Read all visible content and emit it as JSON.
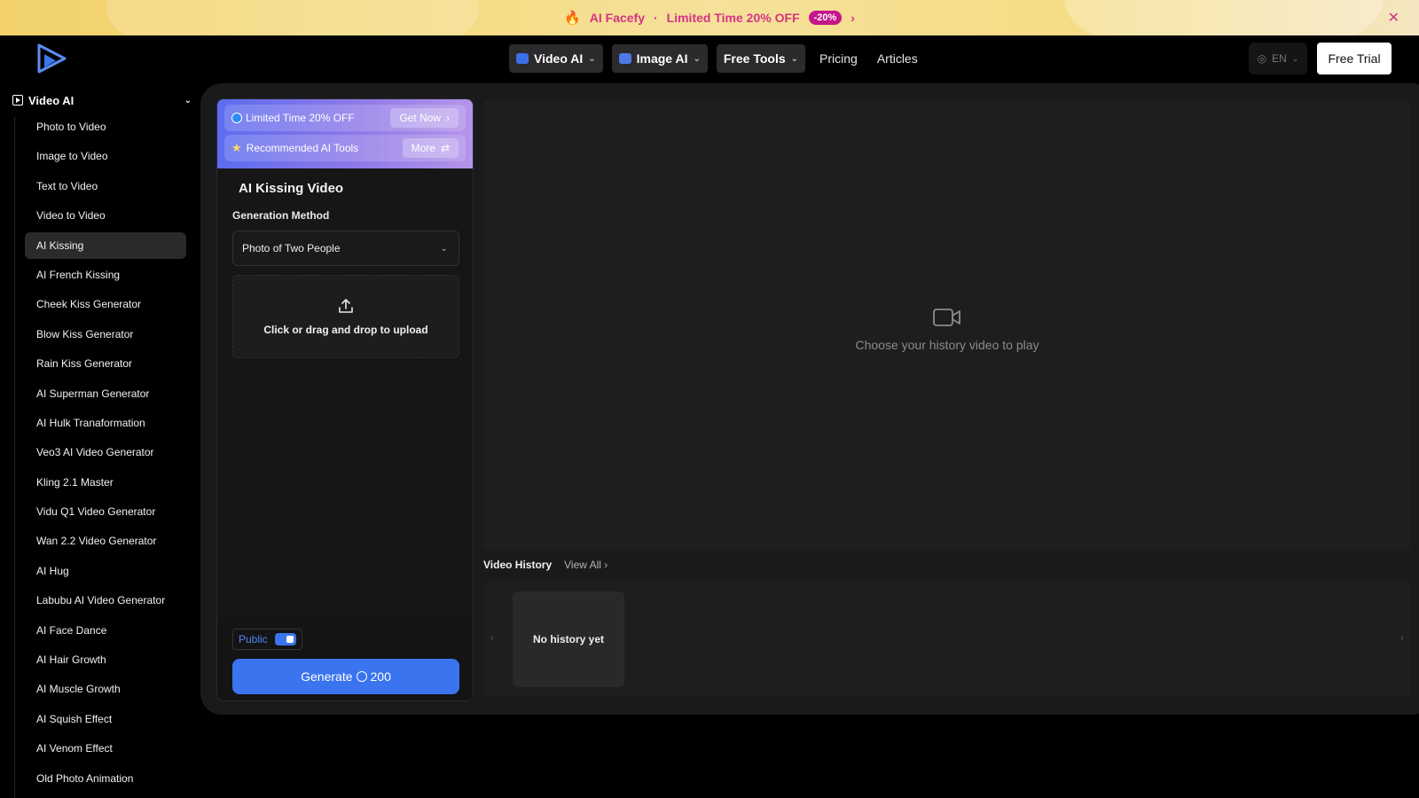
{
  "banner": {
    "brand": "AI Facefy",
    "separator": "·",
    "offer": "Limited Time 20% OFF",
    "badge": "-20%"
  },
  "nav": {
    "video_ai": "Video AI",
    "image_ai": "Image AI",
    "free_tools": "Free Tools",
    "pricing": "Pricing",
    "articles": "Articles",
    "lang": "EN",
    "free_trial": "Free Trial"
  },
  "sidebar": {
    "section": "Video AI",
    "items": [
      {
        "label": "Photo to Video"
      },
      {
        "label": "Image to Video"
      },
      {
        "label": "Text to Video"
      },
      {
        "label": "Video to Video"
      },
      {
        "label": "AI Kissing"
      },
      {
        "label": "AI French Kissing"
      },
      {
        "label": "Cheek Kiss Generator"
      },
      {
        "label": "Blow Kiss Generator"
      },
      {
        "label": "Rain Kiss Generator"
      },
      {
        "label": "AI Superman Generator"
      },
      {
        "label": "AI Hulk Tranaformation"
      },
      {
        "label": "Veo3 AI Video Generator"
      },
      {
        "label": "Kling 2.1 Master"
      },
      {
        "label": "Vidu Q1 Video Generator"
      },
      {
        "label": "Wan 2.2 Video Generator"
      },
      {
        "label": "AI Hug"
      },
      {
        "label": "Labubu AI Video Generator"
      },
      {
        "label": "AI Face Dance"
      },
      {
        "label": "AI Hair Growth"
      },
      {
        "label": "AI Muscle Growth"
      },
      {
        "label": "AI Squish Effect"
      },
      {
        "label": "AI Venom Effect"
      },
      {
        "label": "Old Photo Animation"
      }
    ],
    "active_index": 4
  },
  "panel": {
    "promo_offer": "Limited Time 20% OFF",
    "promo_cta": "Get Now",
    "recommended": "Recommended AI Tools",
    "more": "More",
    "title": "AI Kissing Video",
    "gen_method_label": "Generation Method",
    "gen_method_value": "Photo of Two People",
    "upload_text": "Click or drag and drop to upload",
    "public_label": "Public",
    "generate_label": "Generate",
    "generate_cost": "200"
  },
  "player": {
    "empty_text": "Choose your history video to play"
  },
  "history": {
    "title": "Video History",
    "view_all": "View All",
    "empty": "No history yet"
  },
  "colors": {
    "accent": "#3b74ef",
    "banner_text": "#d63384",
    "badge_bg": "#c4168a"
  }
}
